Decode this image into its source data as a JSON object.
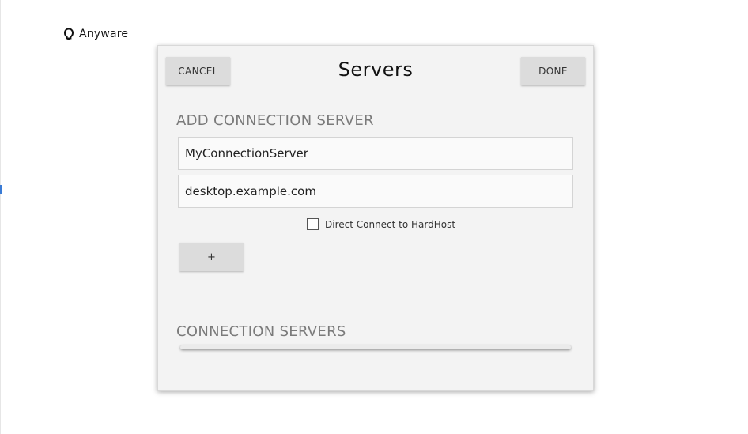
{
  "brand": {
    "name": "Anyware",
    "icon": "anyware-logo-icon"
  },
  "dialog": {
    "title": "Servers",
    "cancel_label": "CANCEL",
    "done_label": "DONE"
  },
  "add_section": {
    "heading": "ADD CONNECTION SERVER",
    "name_value": "MyConnectionServer",
    "host_value": "desktop.example.com",
    "direct_connect_label": "Direct Connect to HardHost",
    "direct_connect_checked": false,
    "add_button_label": "+"
  },
  "list_section": {
    "heading": "CONNECTION SERVERS",
    "servers": []
  }
}
